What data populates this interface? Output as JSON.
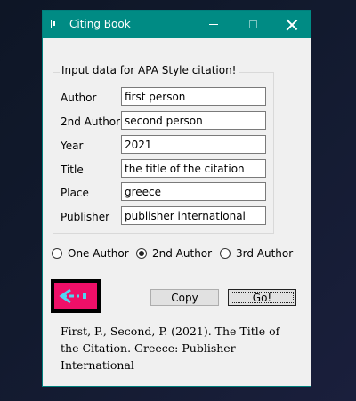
{
  "window": {
    "title": "Citing Book",
    "colors": {
      "titlebar": "#008b84",
      "background": "#f0f0f0"
    }
  },
  "form": {
    "group_title": "Input data for APA Style citation!",
    "fields": [
      {
        "label": "Author",
        "value": "first person"
      },
      {
        "label": "2nd Author",
        "value": "second person"
      },
      {
        "label": "Year",
        "value": "2021"
      },
      {
        "label": "Title",
        "value": "the title of the citation"
      },
      {
        "label": "Place",
        "value": "greece"
      },
      {
        "label": "Publisher",
        "value": "publisher international"
      }
    ]
  },
  "author_options": [
    {
      "label": "One Author",
      "checked": false
    },
    {
      "label": "2nd Author",
      "checked": true
    },
    {
      "label": "3rd Author",
      "checked": false
    }
  ],
  "buttons": {
    "copy": "Copy",
    "go": "Go!"
  },
  "logo": {
    "icon": "back-arrow-icon",
    "colors": {
      "bg": "#ef0f68",
      "arrow": "#4fd6f2"
    }
  },
  "output": {
    "citation": "First, P., Second, P. (2021). The Title of the Citation. Greece: Publisher International"
  }
}
